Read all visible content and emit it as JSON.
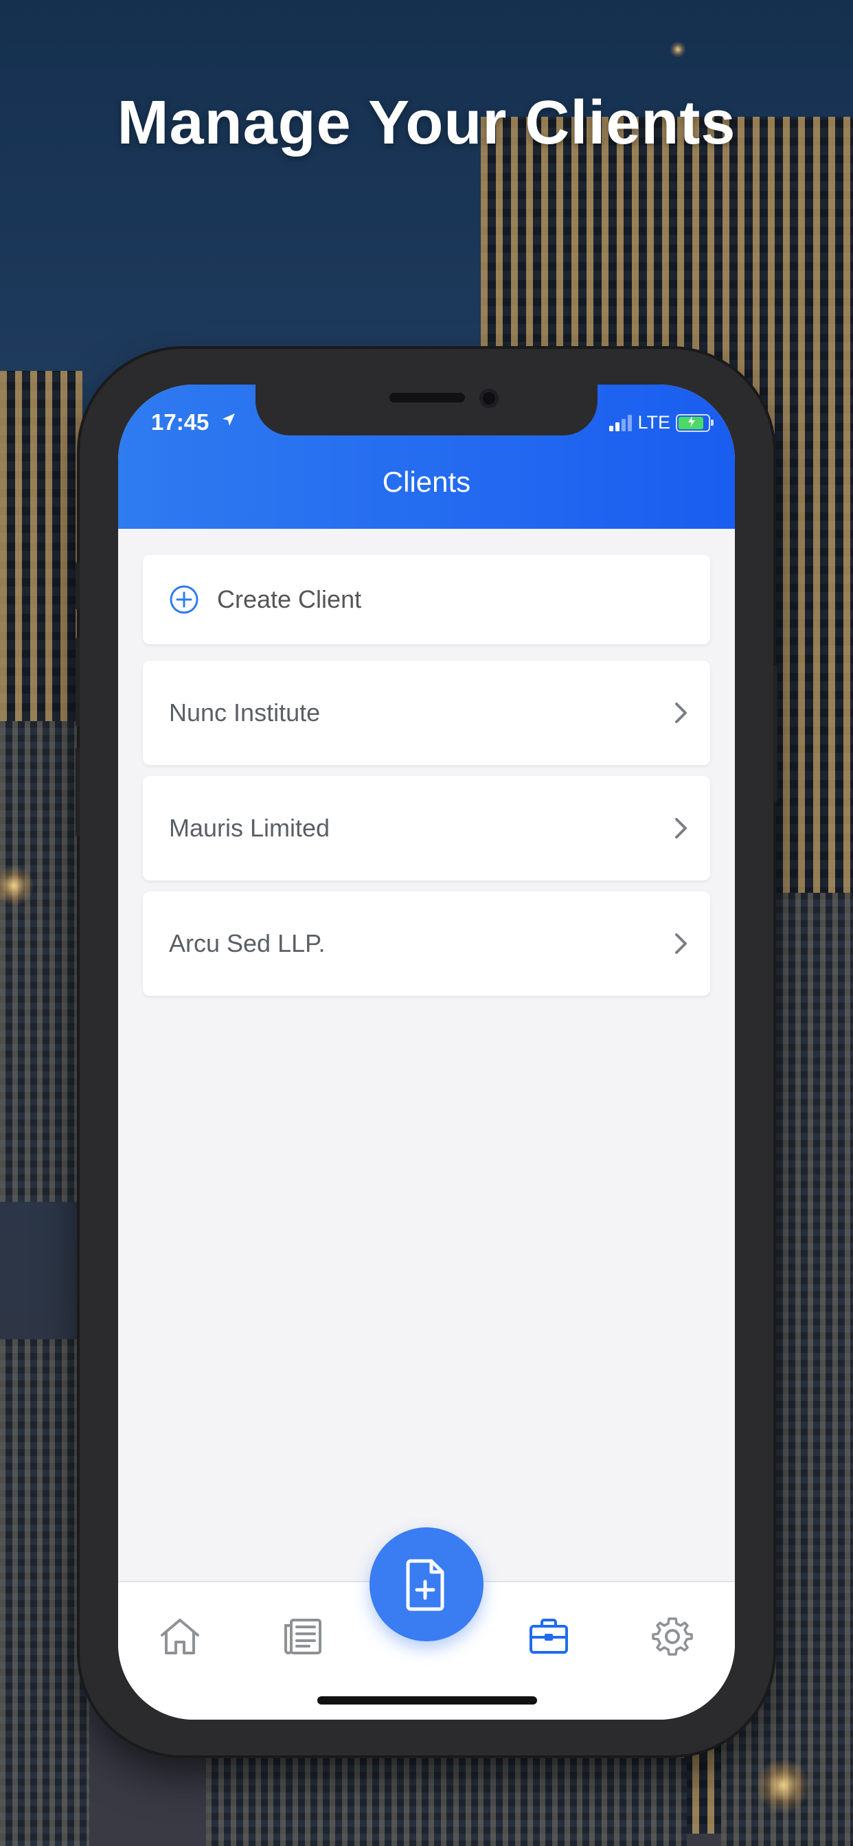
{
  "headline": "Manage Your Clients",
  "status_bar": {
    "time": "17:45",
    "network": "LTE"
  },
  "nav": {
    "title": "Clients"
  },
  "create_client": {
    "label": "Create Client"
  },
  "clients": [
    {
      "name": "Nunc Institute"
    },
    {
      "name": "Mauris Limited"
    },
    {
      "name": "Arcu Sed LLP."
    }
  ],
  "tab_bar": {
    "items": [
      {
        "icon": "home-icon",
        "active": false
      },
      {
        "icon": "newspaper-icon",
        "active": false
      },
      {
        "icon": "new-document-icon",
        "active": false
      },
      {
        "icon": "briefcase-icon",
        "active": true
      },
      {
        "icon": "gear-icon",
        "active": false
      }
    ]
  },
  "colors": {
    "accent": "#2f7bf0",
    "header_start": "#2f7bf0",
    "header_end": "#1a5df0",
    "inactive_icon": "#8e9196",
    "battery": "#4cd964"
  }
}
